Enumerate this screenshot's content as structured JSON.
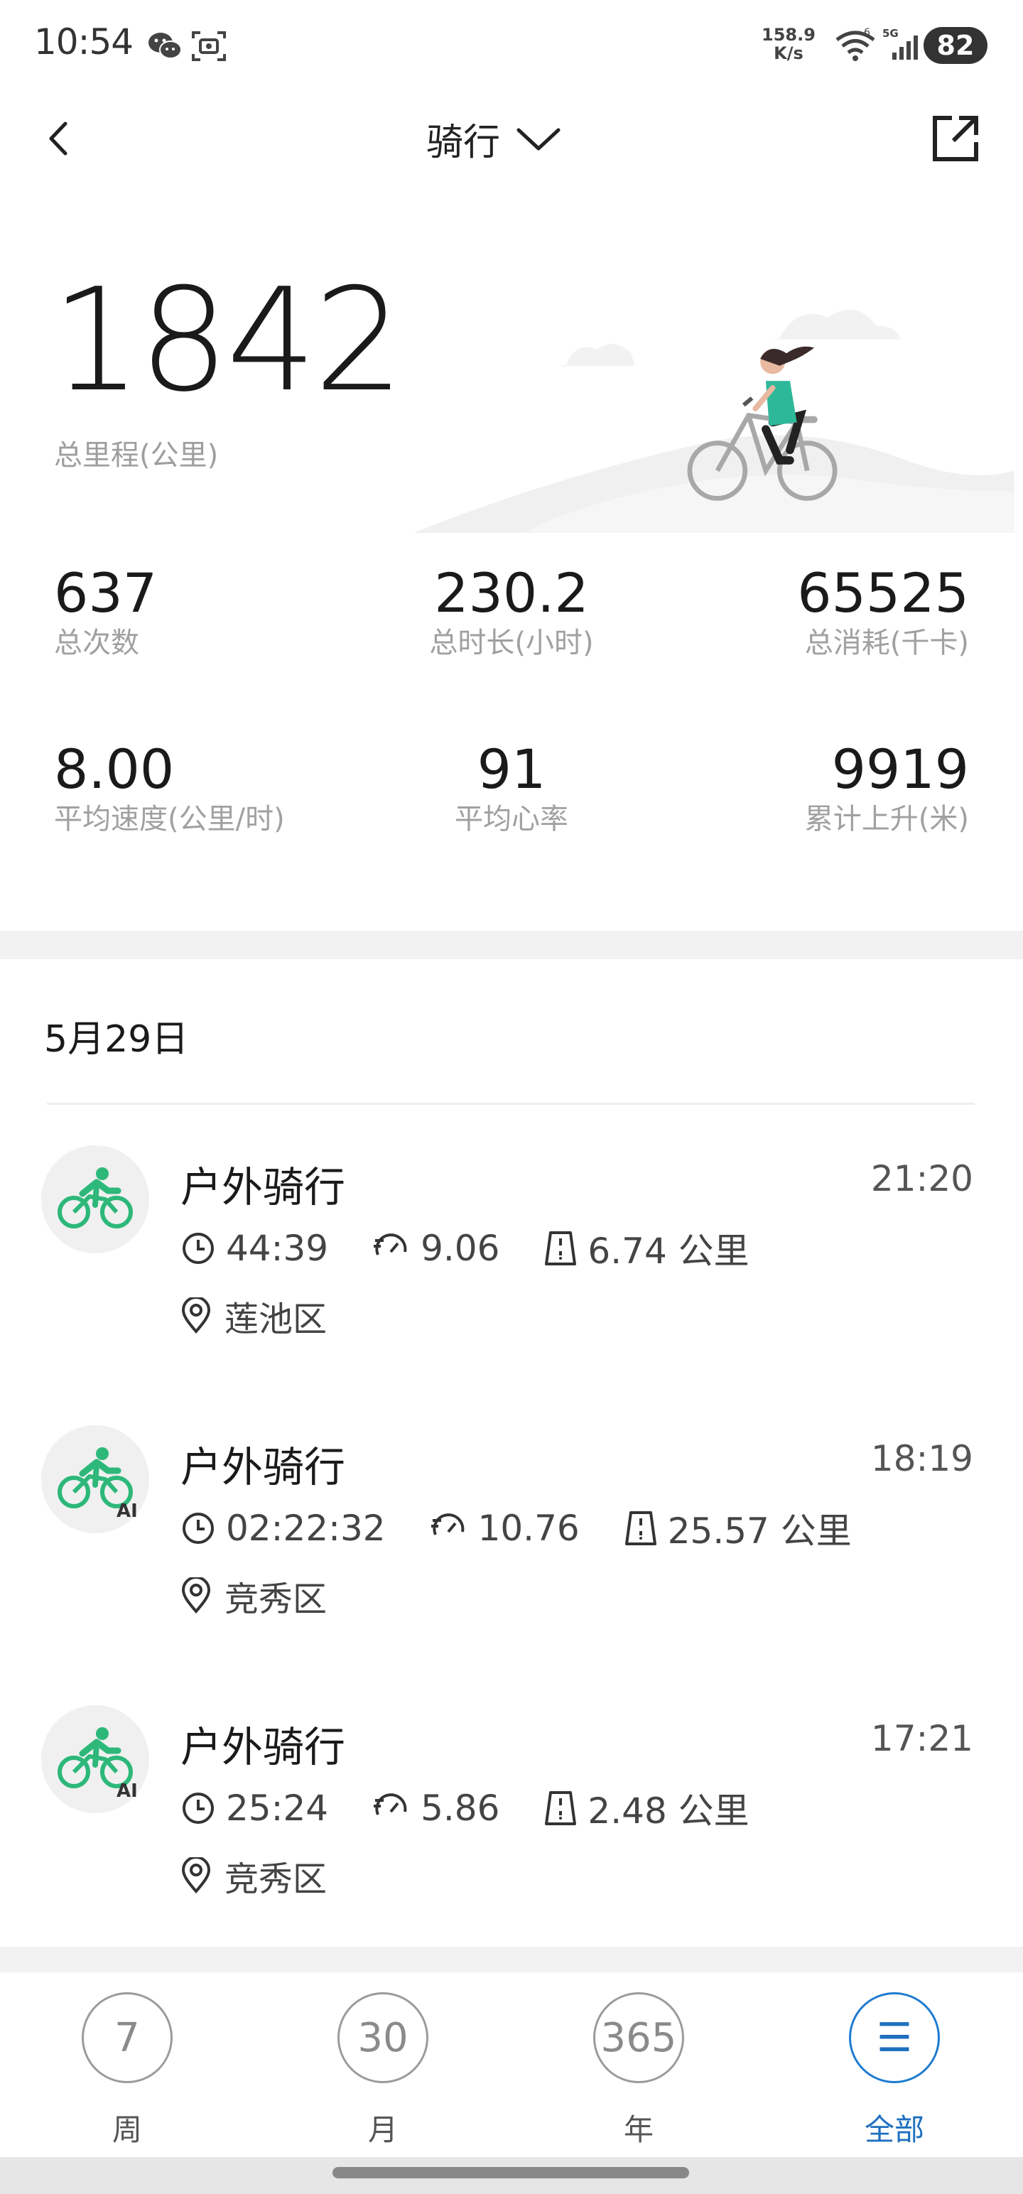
{
  "status_bar": {
    "time": "10:54",
    "net_speed_value": "158.9",
    "net_speed_unit": "K/s",
    "battery": "82"
  },
  "header": {
    "title": "骑行"
  },
  "summary": {
    "total_distance": "1842",
    "total_distance_label": "总里程(公里)",
    "stats_row1": [
      {
        "value": "637",
        "label": "总次数"
      },
      {
        "value": "230.2",
        "label": "总时长(小时)"
      },
      {
        "value": "65525",
        "label": "总消耗(千卡)"
      }
    ],
    "stats_row2": [
      {
        "value": "8.00",
        "label": "平均速度(公里/时)"
      },
      {
        "value": "91",
        "label": "平均心率"
      },
      {
        "value": "9919",
        "label": "累计上升(米)"
      }
    ]
  },
  "records_section": {
    "date": "5月29日",
    "records": [
      {
        "title": "户外骑行",
        "time": "21:20",
        "duration": "44:39",
        "pace": "9.06",
        "distance": "6.74 公里",
        "location": "莲池区",
        "ai": ""
      },
      {
        "title": "户外骑行",
        "time": "18:19",
        "duration": "02:22:32",
        "pace": "10.76",
        "distance": "25.57 公里",
        "location": "竞秀区",
        "ai": "AI"
      },
      {
        "title": "户外骑行",
        "time": "17:21",
        "duration": "25:24",
        "pace": "5.86",
        "distance": "2.48 公里",
        "location": "竞秀区",
        "ai": "AI"
      }
    ]
  },
  "tabbar": {
    "tabs": [
      {
        "circle": "7",
        "label": "周"
      },
      {
        "circle": "30",
        "label": "月"
      },
      {
        "circle": "365",
        "label": "年"
      },
      {
        "circle": "☰",
        "label": "全部"
      }
    ],
    "active_index": 3
  },
  "colors": {
    "accent_green": "#2db87a",
    "active_blue": "#1e6fbf"
  }
}
